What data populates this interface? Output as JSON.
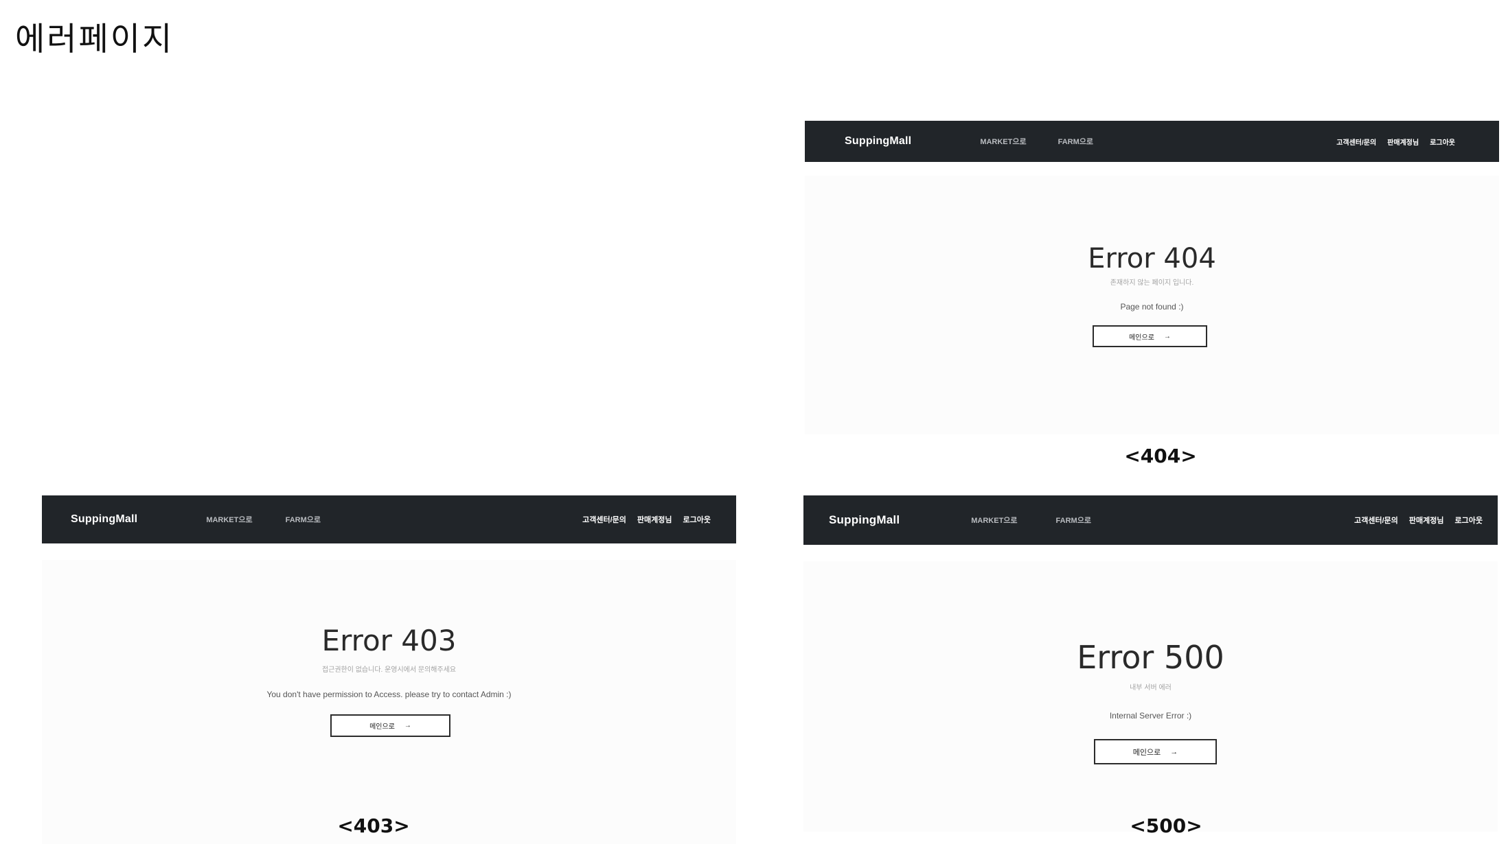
{
  "page": {
    "title": "에러페이지"
  },
  "navbar": {
    "brand": "SuppingMall",
    "links": [
      "MARKET으로",
      "FARM으로"
    ],
    "right_links": [
      "고객센터/문의",
      "판매계정님",
      "로그아웃"
    ]
  },
  "errors": {
    "e404": {
      "title": "Error 404",
      "subtitle": "존재하지 않는 페이지 입니다.",
      "message": "Page not found :)",
      "button": "메인으로",
      "arrow": "→",
      "caption": "<404>"
    },
    "e403": {
      "title": "Error 403",
      "subtitle": "접근권한이 없습니다. 운영시에서 문의해주세요",
      "message": "You don't have permission to Access. please try to contact Admin :)",
      "button": "메인으로",
      "arrow": "→",
      "caption": "<403>"
    },
    "e500": {
      "title": "Error 500",
      "subtitle": "내부 서버 에러",
      "message": "Internal Server Error :)",
      "button": "메인으로",
      "arrow": "→",
      "caption": "<500>"
    }
  },
  "colors": {
    "navbar_bg": "#212529",
    "content_bg": "#fcfcfc",
    "button_border": "#2b2b2b"
  }
}
